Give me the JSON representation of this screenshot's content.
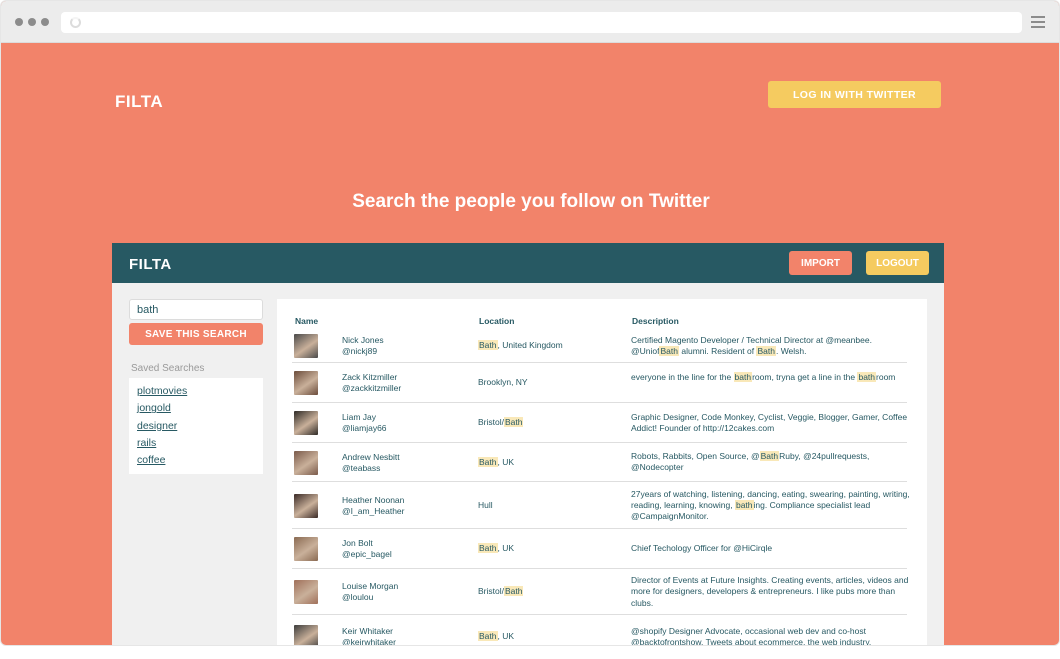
{
  "site": {
    "logo": "FILTA",
    "login_button": "LOG IN WITH TWITTER",
    "hero_title": "Search the people you follow on Twitter"
  },
  "app": {
    "logo": "FILTA",
    "import_button": "IMPORT",
    "logout_button": "LOGOUT"
  },
  "sidebar": {
    "search_value": "bath",
    "save_button": "SAVE THIS SEARCH",
    "saved_title": "Saved Searches",
    "saved_searches": [
      "plotmovies",
      "jongold",
      "designer",
      "rails",
      "coffee"
    ]
  },
  "table": {
    "columns": [
      "Name",
      "Location",
      "Description"
    ],
    "highlight": "bath",
    "rows": [
      {
        "name": "Nick Jones",
        "handle": "@nickj89",
        "location": "Bath, United Kingdom",
        "description": "Certified Magento Developer / Technical Director at @meanbee. @UniofBath alumni. Resident of Bath. Welsh.",
        "avatar_color": "#4a4a4a"
      },
      {
        "name": "Zack Kitzmiller",
        "handle": "@zackkitzmiller",
        "location": "Brooklyn, NY",
        "description": "everyone in the line for the bathroom, tryna get a line in the bathroom",
        "avatar_color": "#6b4c3b"
      },
      {
        "name": "Liam Jay",
        "handle": "@liamjay66",
        "location": "Bristol/Bath",
        "description": "Graphic Designer, Code Monkey, Cyclist, Veggie, Blogger, Gamer, Coffee Addict! Founder of http://12cakes.com",
        "avatar_color": "#2e2a26"
      },
      {
        "name": "Andrew Nesbitt",
        "handle": "@teabass",
        "location": "Bath, UK",
        "description": "Robots, Rabbits, Open Source, @BathRuby, @24pullrequests, @Nodecopter",
        "avatar_color": "#7a5a4a"
      },
      {
        "name": "Heather Noonan",
        "handle": "@I_am_Heather",
        "location": "Hull",
        "description": "27years of watching, listening, dancing, eating, swearing, painting, writing, reading, learning, knowing, bathing. Compliance specialist lead @CampaignMonitor.",
        "avatar_color": "#3a2a26"
      },
      {
        "name": "Jon Bolt",
        "handle": "@epic_bagel",
        "location": "Bath, UK",
        "description": "Chief Techology Officer for @HiCirqle",
        "avatar_color": "#8a6a52"
      },
      {
        "name": "Louise Morgan",
        "handle": "@loulou",
        "location": "Bristol/Bath",
        "description": "Director of Events at Future Insights. Creating events, articles, videos and more for designers, developers & entrepreneurs. I like pubs more than clubs.",
        "avatar_color": "#a0705a"
      },
      {
        "name": "Keir Whitaker",
        "handle": "@keirwhitaker",
        "location": "Bath, UK",
        "description": "@shopify Designer Advocate, occasional web dev and co-host @backtofrontshow. Tweets about ecommerce, the web industry.",
        "avatar_color": "#3c3c3c"
      }
    ]
  },
  "colors": {
    "page_bg": "#f2836a",
    "header_bg": "#275963",
    "accent_yellow": "#f5cb60",
    "highlight": "#f9e8b8"
  }
}
